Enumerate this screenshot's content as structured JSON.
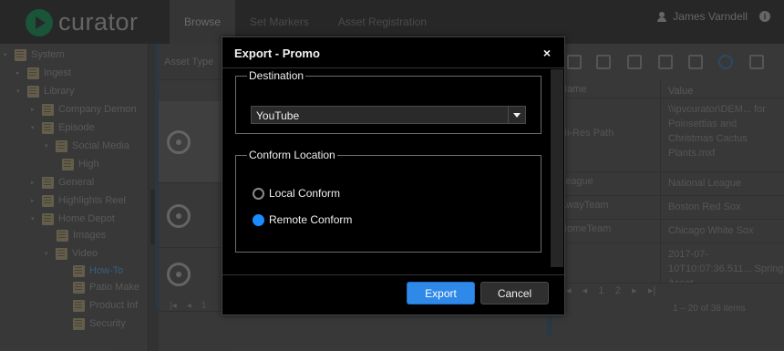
{
  "app": {
    "logo_text": "curator"
  },
  "nav": {
    "tabs": [
      "Browse",
      "Set Markers",
      "Asset Registration"
    ]
  },
  "user": {
    "name": "James Varndell"
  },
  "tree": {
    "items": [
      {
        "label": "System",
        "arrow": "▾"
      },
      {
        "label": "Ingest",
        "arrow": "▸"
      },
      {
        "label": "Library",
        "arrow": "▾"
      },
      {
        "label": "Company Demon",
        "arrow": "▸"
      },
      {
        "label": "Episode",
        "arrow": "▾"
      },
      {
        "label": "Social Media",
        "arrow": "▾"
      },
      {
        "label": "High",
        "arrow": ""
      },
      {
        "label": "General",
        "arrow": "▸"
      },
      {
        "label": "Highlights Reel",
        "arrow": "▸"
      },
      {
        "label": "Home Depot",
        "arrow": "▾"
      },
      {
        "label": "Images",
        "arrow": ""
      },
      {
        "label": "Video",
        "arrow": "▾"
      },
      {
        "label": "How-To",
        "arrow": ""
      },
      {
        "label": "Patio Make",
        "arrow": ""
      },
      {
        "label": "Product Inf",
        "arrow": ""
      },
      {
        "label": "Security",
        "arrow": ""
      }
    ]
  },
  "assets": {
    "header": "Asset Type",
    "pager": "1"
  },
  "metadata": {
    "columns": [
      "Name",
      "Value"
    ],
    "rows": [
      {
        "name": "Hi-Res Path",
        "value": "\\\\ipvcurator\\DEM... for Poinsettias and Christmas Cactus Plants.mxf"
      },
      {
        "name": "League",
        "value": "National League"
      },
      {
        "name": "AwayTeam",
        "value": "Boston Red Sox"
      },
      {
        "name": "HomeTeam",
        "value": "Chicago White Sox"
      },
      {
        "name": "",
        "value": "2017-07-10T10:07:36.511... Spring Asset"
      }
    ],
    "pages": [
      "1",
      "2"
    ],
    "count": "1 – 20 of 38 items"
  },
  "modal": {
    "title": "Export - Promo",
    "close": "×",
    "destination": {
      "legend": "Destination",
      "selected": "YouTube"
    },
    "conform": {
      "legend": "Conform Location",
      "options": [
        {
          "label": "Local Conform",
          "checked": false
        },
        {
          "label": "Remote Conform",
          "checked": true
        }
      ]
    },
    "export_label": "Export",
    "cancel_label": "Cancel"
  },
  "colors": {
    "accent": "#2f89e8",
    "radio_selected": "#1a8cff",
    "modal_bg": "#000000"
  }
}
